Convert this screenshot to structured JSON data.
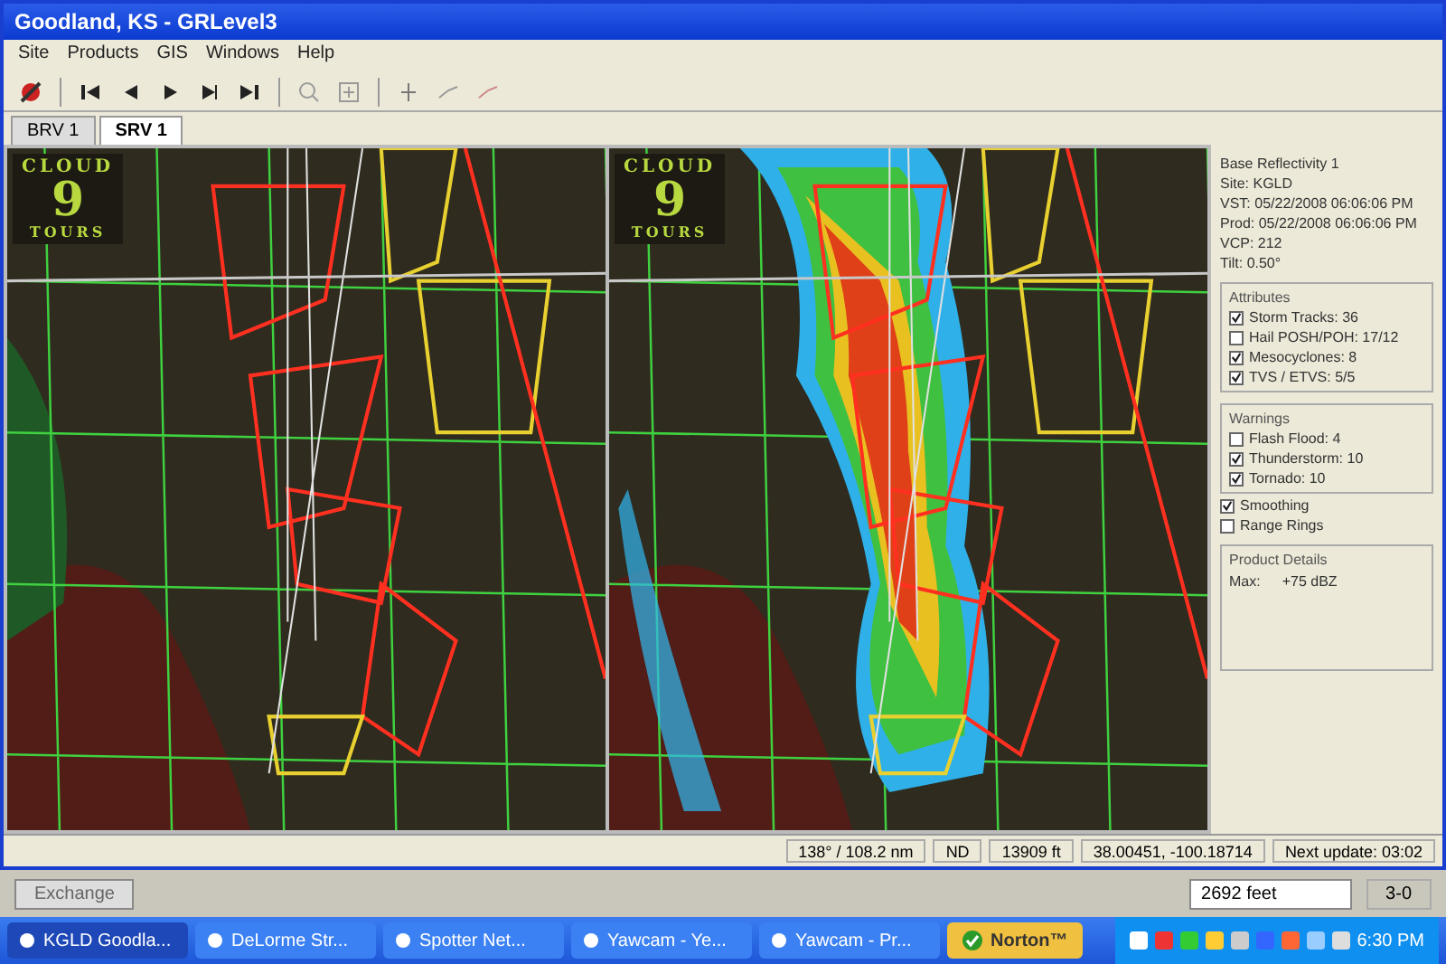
{
  "window": {
    "title": "Goodland, KS - GRLevel3"
  },
  "menu": [
    "Site",
    "Products",
    "GIS",
    "Windows",
    "Help"
  ],
  "tabs": [
    {
      "label": "BRV 1",
      "selected": false
    },
    {
      "label": "SRV 1",
      "selected": true
    }
  ],
  "panels": [
    {
      "kind": "velocity",
      "logo": [
        "CLOUD",
        "9",
        "TOURS"
      ]
    },
    {
      "kind": "reflectivity",
      "logo": [
        "CLOUD",
        "9",
        "TOURS"
      ]
    }
  ],
  "sidebar": {
    "product": "Base Reflectivity 1",
    "info": [
      "Site: KGLD",
      "VST: 05/22/2008 06:06:06 PM",
      "Prod: 05/22/2008 06:06:06 PM",
      "VCP: 212",
      "Tilt: 0.50°"
    ],
    "groups": [
      {
        "title": "Attributes",
        "items": [
          {
            "label": "Storm Tracks: 36",
            "checked": true
          },
          {
            "label": "Hail POSH/POH: 17/12",
            "checked": false
          },
          {
            "label": "Mesocyclones: 8",
            "checked": true
          },
          {
            "label": "TVS / ETVS: 5/5",
            "checked": true
          }
        ]
      },
      {
        "title": "Warnings",
        "items": [
          {
            "label": "Flash Flood: 4",
            "checked": false
          },
          {
            "label": "Thunderstorm: 10",
            "checked": true
          },
          {
            "label": "Tornado: 10",
            "checked": true
          }
        ]
      }
    ],
    "options": [
      {
        "label": "Smoothing",
        "checked": true
      },
      {
        "label": "Range Rings",
        "checked": false
      }
    ],
    "details": {
      "title": "Product Details",
      "label": "Max:",
      "value": "+75 dBZ"
    }
  },
  "status_bar": [
    "138° / 108.2 nm",
    "ND",
    "13909 ft",
    "38.00451, -100.18714",
    "Next update: 03:02"
  ],
  "lower_strip": {
    "button": "Exchange",
    "field": "2692 feet",
    "value": "3-0"
  },
  "taskbar": {
    "items": [
      {
        "label": "KGLD Goodla...",
        "selected": true
      },
      {
        "label": "DeLorme Str...",
        "selected": false
      },
      {
        "label": "Spotter Net...",
        "selected": false
      },
      {
        "label": "Yawcam - Ye...",
        "selected": false
      },
      {
        "label": "Yawcam - Pr...",
        "selected": false
      }
    ],
    "norton": "Norton™",
    "clock": "6:30 PM"
  }
}
